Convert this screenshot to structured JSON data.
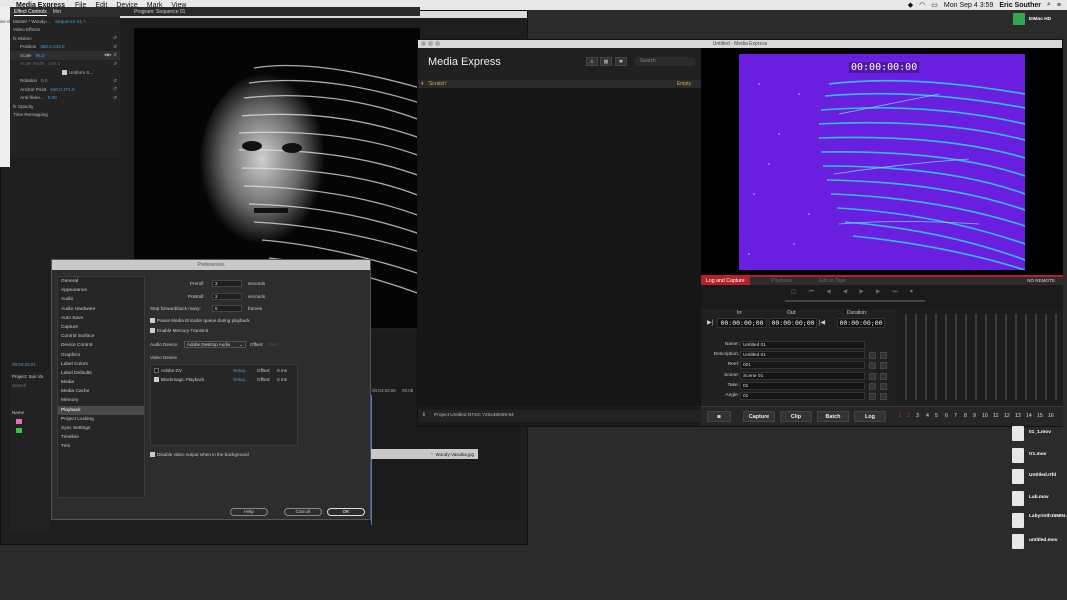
{
  "menubar": {
    "app_name": "Media Express",
    "items": [
      "File",
      "Edit",
      "Device",
      "Mark",
      "View"
    ],
    "datetime": "Mon Sep 4  3:59",
    "user": "Eric Souther"
  },
  "premiere": {
    "left_strip_label": "ive clip)",
    "effect_controls": {
      "tab_label": "Effect Controls",
      "tab2_label": "Met",
      "master_label": "Master * Woody-...",
      "sequence_label": "Sequence 01 *...",
      "section": "Video Effects",
      "rows": [
        {
          "label": "fx Motion",
          "value": ""
        },
        {
          "label": "Position",
          "value": "360.0   243.0"
        },
        {
          "label": "Scale",
          "value": "96.0"
        },
        {
          "label": "Scale Width",
          "value": "100.0"
        },
        {
          "label": "Uniform S...",
          "value": ""
        },
        {
          "label": "Rotation",
          "value": "0.0"
        },
        {
          "label": "Anchor Point",
          "value": "640.0   471.0"
        },
        {
          "label": "Anti-flicke...",
          "value": "0.00"
        },
        {
          "label": "fx Opacity",
          "value": ""
        },
        {
          "label": "Time Remapping",
          "value": ""
        }
      ]
    },
    "program_tab": "Program: Sequence 01",
    "timecode": "00:04:20:01",
    "project_label": "Project: Sun Va",
    "project_search": "Search",
    "name_column": "Name",
    "clip_label": "Woody-Vasulka.jpg",
    "timeline_time": "00:04:20:08",
    "timeline_time2": "00:05"
  },
  "preferences": {
    "title": "Preferences",
    "categories": [
      "General",
      "Appearance",
      "Audio",
      "Audio Hardware",
      "Auto Save",
      "Capture",
      "Control Surface",
      "Device Control",
      "Graphics",
      "Label Colors",
      "Label Defaults",
      "Media",
      "Media Cache",
      "Memory",
      "Playback",
      "Project Locking",
      "Sync Settings",
      "Timeline",
      "Trim"
    ],
    "selected": "Playback",
    "preroll_label": "Preroll:",
    "preroll_value": "3",
    "postroll_label": "Postroll:",
    "postroll_value": "2",
    "seconds": "seconds",
    "step_label": "Step forward/back many:",
    "step_value": "5",
    "frames": "frames",
    "pause_label": "Pause Media Encoder queue during playback",
    "mercury_label": "Enable Mercury Transmit",
    "audio_device_label": "Audio Device:",
    "audio_device_value": "Adobe Desktop Audio",
    "offset_label": "Offset:",
    "offset_placeholder": "0ms",
    "video_device_label": "Video Device",
    "devices": [
      {
        "name": "Adobe DV",
        "setup": "Setup...",
        "offset": "Offset:",
        "offset_val": "0 ms",
        "checked": false
      },
      {
        "name": "Blackmagic Playback",
        "setup": "Setup...",
        "offset": "Offset:",
        "offset_val": "0 ms",
        "checked": true
      }
    ],
    "disable_bg_label": "Disable video output when in the background",
    "help": "Help",
    "cancel": "Cancel",
    "ok": "OK"
  },
  "media_express": {
    "window_title": "Untitled - Media Express",
    "brand": "Media Express",
    "search_placeholder": "Search",
    "bin_name": "'Scratch'",
    "bin_status": "Empty",
    "status_bar": "Project Untitled  NTSC 720x486i59.94",
    "timecode_overlay": "00:00:00:00",
    "tabs": [
      "Log and Capture",
      "Playback",
      "Edit to Tape"
    ],
    "no_remote": "NO REMOTE",
    "in_label": "In:",
    "out_label": "Out:",
    "duration_label": "Duration:",
    "in_tc": "00:00:00;00",
    "out_tc": "00:00:00;00",
    "duration_tc": "00:00:00;00",
    "fields": [
      {
        "label": "Name:",
        "value": "Untitled 01"
      },
      {
        "label": "Description:",
        "value": "Untitled 01"
      },
      {
        "label": "Reel:",
        "value": "001"
      },
      {
        "label": "Scene:",
        "value": "Scene 01"
      },
      {
        "label": "Take:",
        "value": "01"
      },
      {
        "label": "Angle:",
        "value": "01"
      }
    ],
    "buttons": [
      "Capture",
      "Clip",
      "Batch",
      "Log"
    ],
    "channel_numbers": [
      "1",
      "2",
      "3",
      "4",
      "5",
      "6",
      "7",
      "8",
      "9",
      "10",
      "11",
      "12",
      "13",
      "14",
      "15",
      "16"
    ],
    "colors": {
      "accent": "#b5202a",
      "preview": "#6a1fe0"
    }
  },
  "desktop": {
    "drive": "EIMac HD",
    "files": [
      "01_1.mov",
      "tr1.mov",
      "Untitled.rtfd",
      "Lab.mov",
      "Labyrinth15MIN.mov",
      "untitled.mov"
    ]
  }
}
